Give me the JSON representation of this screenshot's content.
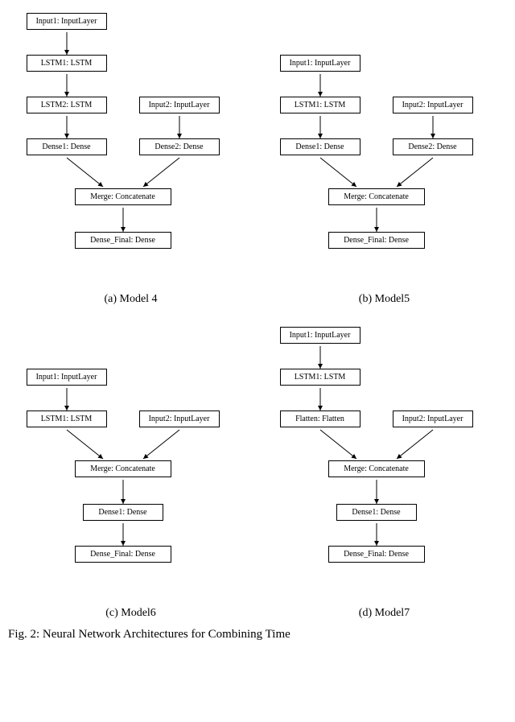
{
  "nodes": {
    "input1": "Input1: InputLayer",
    "input2": "Input2: InputLayer",
    "lstm1": "LSTM1: LSTM",
    "lstm2": "LSTM2: LSTM",
    "dense1": "Dense1: Dense",
    "dense2": "Dense2: Dense",
    "merge": "Merge: Concatenate",
    "flatten": "Flatten: Flatten",
    "dense_final": "Dense_Final: Dense"
  },
  "captions": {
    "a": "(a) Model 4",
    "b": "(b) Model5",
    "c": "(c) Model6",
    "d": "(d) Model7"
  },
  "figure_caption": "Fig. 2: Neural Network Architectures for Combining Time"
}
